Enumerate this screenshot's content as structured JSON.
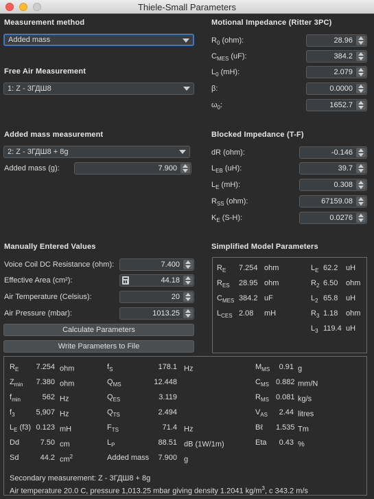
{
  "window": {
    "title": "Thiele-Small Parameters"
  },
  "measurement_method": {
    "title": "Measurement method",
    "selected": "Added mass"
  },
  "free_air": {
    "title": "Free Air Measurement",
    "selected": "1: Z - 3ГДШ8"
  },
  "added_mass": {
    "title": "Added mass measurement",
    "selected": "2: Z - 3ГДШ8 + 8g",
    "mass_label": "Added mass (g):",
    "mass_value": "7.900"
  },
  "motional": {
    "title": "Motional Impedance (Ritter 3PC)",
    "rows": [
      {
        "label": "R",
        "sub": "0",
        "unit": " (ohm):",
        "value": "28.96"
      },
      {
        "label": "C",
        "sub": "MES",
        "unit": " (uF):",
        "value": "384.2"
      },
      {
        "label": "L",
        "sub": "0",
        "unit": " (mH):",
        "value": "2.079"
      },
      {
        "label": "β:",
        "sub": "",
        "unit": "",
        "value": "0.0000"
      },
      {
        "label": "ω",
        "sub": "0",
        "unit": ":",
        "value": "1652.7"
      }
    ]
  },
  "blocked": {
    "title": "Blocked Impedance (T-F)",
    "rows": [
      {
        "label": "dR (ohm):",
        "sub": "",
        "unit": "",
        "value": "-0.146"
      },
      {
        "label": "L",
        "sub": "EB",
        "unit": " (uH):",
        "value": "39.7"
      },
      {
        "label": "L",
        "sub": "E",
        "unit": " (mH):",
        "value": "0.308"
      },
      {
        "label": "R",
        "sub": "SS",
        "unit": " (ohm):",
        "value": "67159.08"
      },
      {
        "label": "K",
        "sub": "E",
        "unit": " (S-H):",
        "value": "0.0276"
      }
    ]
  },
  "manual": {
    "title": "Manually Entered Values",
    "rows": [
      {
        "label": "Voice Coil DC Resistance (ohm):",
        "value": "7.400"
      },
      {
        "label": "Effective Area (cm²):",
        "value": "44.18"
      },
      {
        "label": "Air Temperature (Celsius):",
        "value": "20"
      },
      {
        "label": "Air Pressure (mbar):",
        "value": "1013.25"
      }
    ],
    "calculate_label": "Calculate Parameters",
    "write_label": "Write Parameters to File"
  },
  "simplified": {
    "title": "Simplified Model Parameters",
    "left": [
      {
        "label": "R",
        "sub": "E",
        "value": "7.254",
        "unit": "ohm"
      },
      {
        "label": "R",
        "sub": "ES",
        "value": "28.95",
        "unit": "ohm"
      },
      {
        "label": "C",
        "sub": "MES",
        "value": "384.2",
        "unit": "uF"
      },
      {
        "label": "L",
        "sub": "CES",
        "value": "2.08",
        "unit": "mH"
      }
    ],
    "right": [
      {
        "label": "L",
        "sub": "E",
        "value": "62.2",
        "unit": "uH"
      },
      {
        "label": "R",
        "sub": "2",
        "value": "6.50",
        "unit": "ohm"
      },
      {
        "label": "L",
        "sub": "2",
        "value": "65.8",
        "unit": "uH"
      },
      {
        "label": "R",
        "sub": "3",
        "value": "1.18",
        "unit": "ohm"
      },
      {
        "label": "L",
        "sub": "3",
        "value": "119.4",
        "unit": "uH"
      }
    ]
  },
  "results": {
    "col1": [
      {
        "label": "R",
        "sub": "E",
        "value": "7.254",
        "unit": "ohm"
      },
      {
        "label": "Z",
        "sub": "min",
        "value": "7.380",
        "unit": "ohm"
      },
      {
        "label": "f",
        "sub": "min",
        "value": "562",
        "unit": "Hz"
      },
      {
        "label": "f",
        "sub": "3",
        "value": "5,907",
        "unit": "Hz"
      },
      {
        "label": "L",
        "sub": "E",
        "extra": " (f3)",
        "value": "0.123",
        "unit": "mH"
      },
      {
        "label": "Dd",
        "sub": "",
        "value": "7.50",
        "unit": "cm"
      },
      {
        "label": "Sd",
        "sub": "",
        "value": "44.2",
        "unit": "cm",
        "sup": "2"
      }
    ],
    "col2": [
      {
        "label": "f",
        "sub": "S",
        "value": "178.1",
        "unit": "Hz"
      },
      {
        "label": "Q",
        "sub": "MS",
        "value": "12.448",
        "unit": ""
      },
      {
        "label": "Q",
        "sub": "ES",
        "value": "3.119",
        "unit": ""
      },
      {
        "label": "Q",
        "sub": "TS",
        "value": "2.494",
        "unit": ""
      },
      {
        "label": "F",
        "sub": "TS",
        "value": "71.4",
        "unit": "Hz"
      },
      {
        "label": "L",
        "sub": "P",
        "value": "88.51",
        "unit": "dB (1W/1m)"
      },
      {
        "label": "Added mass",
        "sub": "",
        "value": "7.900",
        "unit": "g"
      }
    ],
    "col3": [
      {
        "label": "M",
        "sub": "MS",
        "value": "0.91",
        "unit": "g"
      },
      {
        "label": "C",
        "sub": "MS",
        "value": "0.882",
        "unit": "mm/N"
      },
      {
        "label": "R",
        "sub": "MS",
        "value": "0.081",
        "unit": "kg/s"
      },
      {
        "label": "V",
        "sub": "AS",
        "value": "2.44",
        "unit": "litres"
      },
      {
        "label": "Bℓ",
        "sub": "",
        "value": "1.535",
        "unit": "Tm"
      },
      {
        "label": "Eta",
        "sub": "",
        "value": "0.43",
        "unit": "%"
      }
    ],
    "secondary": "Secondary measurement: Z - 3ГДШ8 + 8g",
    "air_prefix": "Air temperature 20.0 C, pressure 1,013.25 mbar giving density 1.2041 kg/m",
    "air_sup": "3",
    "air_suffix": ", c 343.2 m/s"
  }
}
